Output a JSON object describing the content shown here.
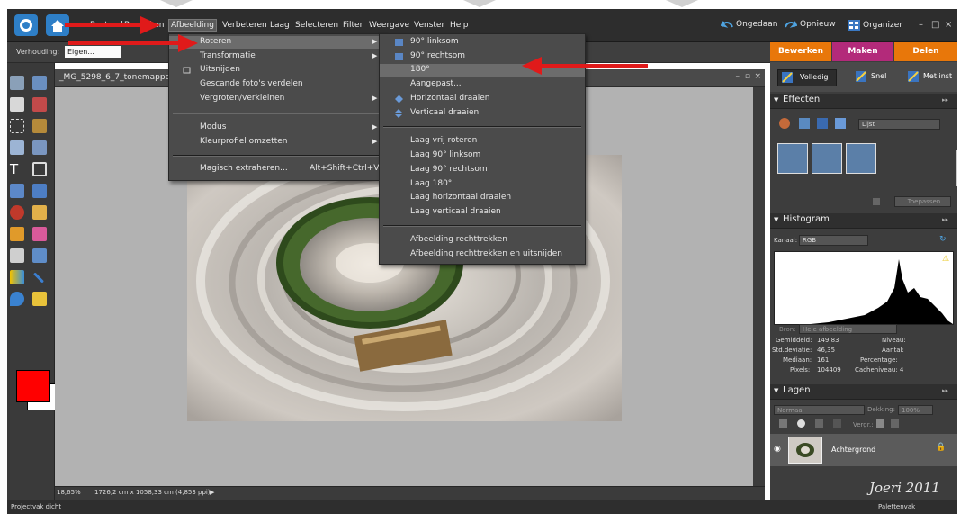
{
  "menubar": {
    "items": [
      "Bestand",
      "Bewerken",
      "Afbeelding",
      "Verbeteren",
      "Laag",
      "Selecteren",
      "Filter",
      "Weergave",
      "Venster",
      "Help"
    ],
    "undo": "Ongedaan",
    "redo": "Opnieuw",
    "organizer": "Organizer"
  },
  "options_bar": {
    "label": "Verhouding:",
    "value": "Eigen..."
  },
  "document": {
    "title": "_MG_5298_6_7_tonemapped.tif",
    "zoom": "18,65%",
    "size": "1726,2 cm x 1058,33 cm (4,853 ppi)"
  },
  "afbeelding_menu": {
    "items": [
      {
        "label": "Roteren",
        "submenu": true
      },
      {
        "label": "Transformatie",
        "submenu": true
      },
      {
        "label": "Uitsnijden",
        "submenu": false
      },
      {
        "label": "Gescande foto's verdelen",
        "submenu": false
      },
      {
        "label": "Vergroten/verkleinen",
        "submenu": true
      },
      {
        "label": "Modus",
        "submenu": true
      },
      {
        "label": "Kleurprofiel omzetten",
        "submenu": true
      },
      {
        "label": "Magisch extraheren...",
        "shortcut": "Alt+Shift+Ctrl+V"
      }
    ]
  },
  "roteren_menu": {
    "items": [
      "90° linksom",
      "90° rechtsom",
      "180°",
      "Aangepast...",
      "Horizontaal draaien",
      "Verticaal draaien",
      "Laag vrij roteren",
      "Laag 90° linksom",
      "Laag 90° rechtsom",
      "Laag 180°",
      "Laag horizontaal draaien",
      "Laag verticaal draaien",
      "Afbeelding rechttrekken",
      "Afbeelding rechttrekken en uitsnijden"
    ],
    "highlighted": "180°"
  },
  "right_panel": {
    "tabs": [
      "Bewerken",
      "Maken",
      "Delen"
    ],
    "modes": [
      "Volledig",
      "Snel",
      "Met inst"
    ],
    "effects": {
      "title": "Effecten",
      "dropdown": "Lijst",
      "apply": "Toepassen"
    },
    "histogram": {
      "title": "Histogram",
      "channel_label": "Kanaal:",
      "channel": "RGB",
      "source_label": "Bron:",
      "source": "Hele afbeelding",
      "stats_left": [
        {
          "label": "Gemiddeld:",
          "value": "149,83"
        },
        {
          "label": "Std.deviatie:",
          "value": "46,35"
        },
        {
          "label": "Mediaan:",
          "value": "161"
        },
        {
          "label": "Pixels:",
          "value": "104409"
        }
      ],
      "stats_right": [
        "Niveau:",
        "Aantal:",
        "Percentage:",
        "Cacheniveau: 4"
      ]
    },
    "layers": {
      "title": "Lagen",
      "blend": "Normaal",
      "opacity_label": "Dekking:",
      "opacity": "100%",
      "lock_label": "Vergr.:",
      "layer_name": "Achtergrond"
    },
    "signature": "Joeri 2011"
  },
  "bottom_bar": {
    "left": "Projectvak dicht",
    "right": "Palettenvak"
  },
  "colors": {
    "foreground": "#ff0000",
    "background": "#ffffff",
    "tab_edit": "#e8770a",
    "tab_make": "#b32a7a",
    "tab_share": "#e8770a",
    "annotation_arrow": "#e01a1a"
  }
}
